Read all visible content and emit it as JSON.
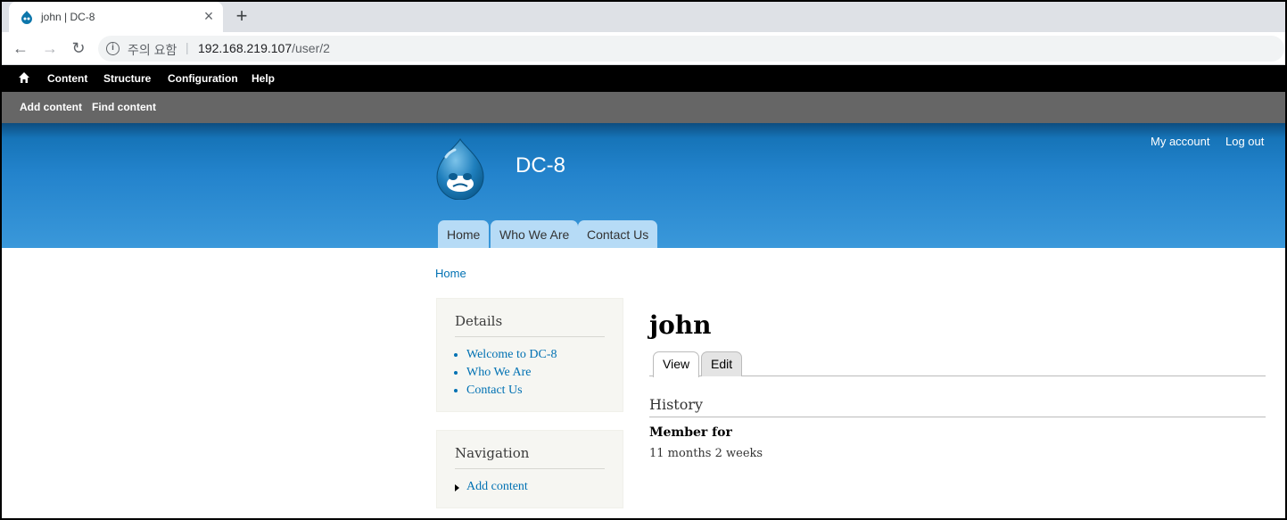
{
  "browser": {
    "tab_title": "john | DC-8",
    "tab_close": "×",
    "new_tab": "+",
    "security_text": "주의 요함",
    "separator": "|",
    "url_host": "192.168.219.107",
    "url_path": "/user/2",
    "back": "←",
    "forward": "→",
    "reload": "↻"
  },
  "admin_toolbar": {
    "items": [
      "Content",
      "Structure",
      "Configuration",
      "Help"
    ],
    "shortcuts": [
      "Add content",
      "Find content"
    ]
  },
  "site": {
    "name": "DC-8",
    "header_links": [
      "My account",
      "Log out"
    ],
    "main_menu": [
      "Home",
      "Who We Are",
      "Contact Us"
    ]
  },
  "breadcrumb": "Home",
  "sidebar": {
    "details": {
      "title": "Details",
      "links": [
        "Welcome to DC-8",
        "Who We Are",
        "Contact Us"
      ]
    },
    "navigation": {
      "title": "Navigation",
      "links": [
        "Add content"
      ]
    }
  },
  "main": {
    "title": "john",
    "tabs": [
      "View",
      "Edit"
    ],
    "history_title": "History",
    "member_for_label": "Member for",
    "member_for_value": "11 months 2 weeks"
  },
  "colors": {
    "link": "#0071b3",
    "admin_bar": "#000000",
    "admin_sub": "#666666",
    "header_blue": "#2383cc",
    "menu_tab": "#b6dbf6"
  }
}
